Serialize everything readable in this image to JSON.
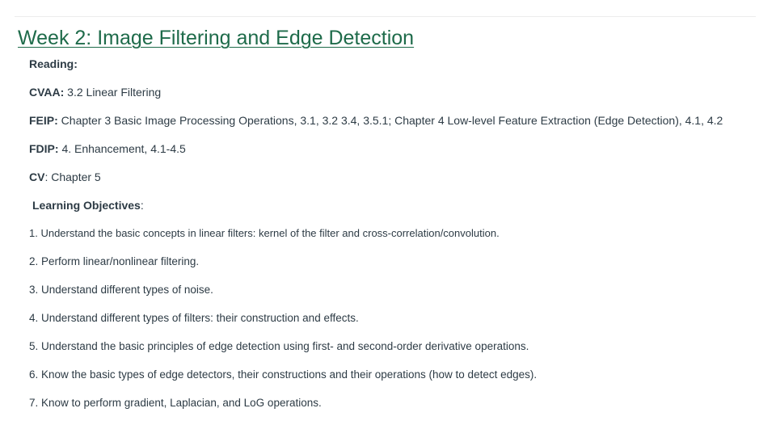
{
  "title": "Week 2: Image Filtering and Edge Detection",
  "reading": {
    "heading": "Reading:",
    "items": [
      {
        "label": "CVAA:",
        "text": " 3.2 Linear Filtering"
      },
      {
        "label": "FEIP:",
        "text": " Chapter 3 Basic Image Processing Operations, 3.1, 3.2 3.4, 3.5.1; Chapter 4 Low-level Feature Extraction (Edge Detection), 4.1, 4.2"
      },
      {
        "label": "FDIP:",
        "text": " 4. Enhancement, 4.1-4.5"
      },
      {
        "label": "CV",
        "text": ": Chapter 5"
      }
    ]
  },
  "objectives": {
    "heading": "Learning Objectives",
    "heading_suffix": ":",
    "items": [
      "1. Understand the basic concepts in linear filters: kernel of the filter and cross-correlation/convolution.",
      "2. Perform linear/nonlinear filtering.",
      "3. Understand different types of noise.",
      "4. Understand different types of filters: their construction and effects.",
      "5. Understand the basic principles of edge detection using first- and second-order derivative operations.",
      "6. Know the basic types of edge detectors, their constructions and their operations (how to detect edges).",
      "7. Know to perform gradient, Laplacian, and LoG operations."
    ]
  }
}
